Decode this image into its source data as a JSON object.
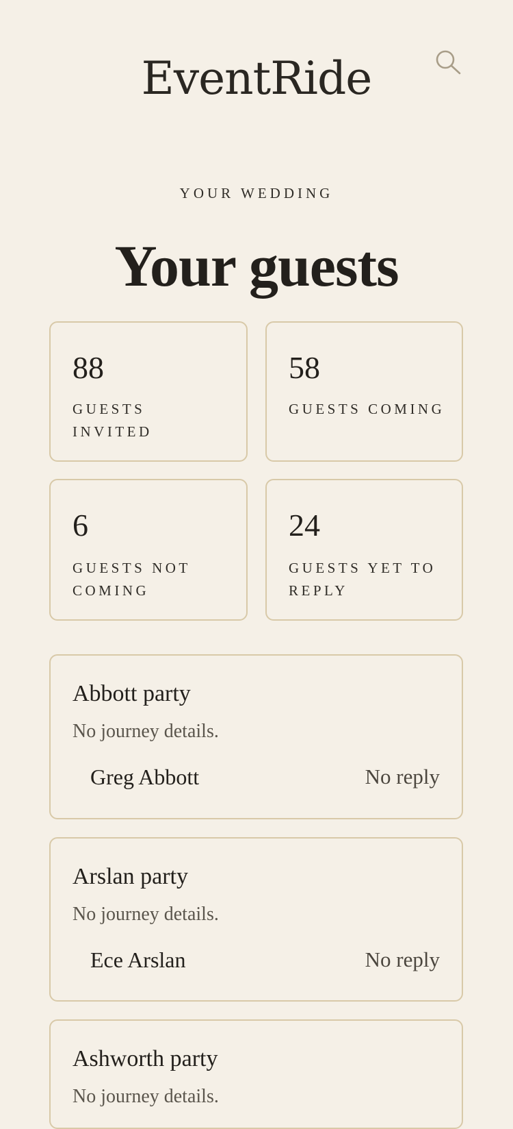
{
  "header": {
    "brand": "EventRide",
    "search_icon": "search-icon"
  },
  "page": {
    "eyebrow": "YOUR WEDDING",
    "title": "Your guests"
  },
  "stats": [
    {
      "value": "88",
      "label": "Guests invited"
    },
    {
      "value": "58",
      "label": "Guests coming"
    },
    {
      "value": "6",
      "label": "Guests not coming"
    },
    {
      "value": "24",
      "label": "Guests yet to reply"
    }
  ],
  "parties": [
    {
      "name": "Abbott party",
      "note": "No journey details.",
      "guests": [
        {
          "name": "Greg Abbott",
          "status": "No reply"
        }
      ]
    },
    {
      "name": "Arslan party",
      "note": "No journey details.",
      "guests": [
        {
          "name": "Ece Arslan",
          "status": "No reply"
        }
      ]
    },
    {
      "name": "Ashworth party",
      "note": "No journey details."
    }
  ],
  "colors": {
    "background": "#f5f0e7",
    "card_border": "#d8c9a8",
    "text": "#23201c",
    "muted_text": "#5a554c",
    "icon": "#a89d88"
  }
}
